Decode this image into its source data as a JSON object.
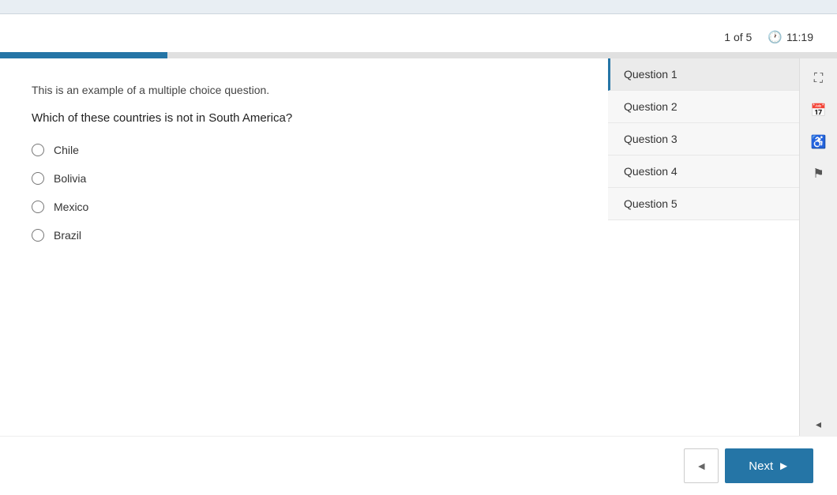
{
  "top_bar": {},
  "header": {
    "page_indicator": "1 of 5",
    "timer_label": "11:19"
  },
  "progress": {
    "fill_percent": 20
  },
  "question": {
    "description": "This is an example of a multiple choice question.",
    "text": "Which of these countries is not in South America?",
    "options": [
      {
        "id": "opt1",
        "label": "Chile"
      },
      {
        "id": "opt2",
        "label": "Bolivia"
      },
      {
        "id": "opt3",
        "label": "Mexico"
      },
      {
        "id": "opt4",
        "label": "Brazil"
      }
    ]
  },
  "nav": {
    "items": [
      {
        "id": "q1",
        "label": "Question 1",
        "active": true
      },
      {
        "id": "q2",
        "label": "Question 2",
        "active": false
      },
      {
        "id": "q3",
        "label": "Question 3",
        "active": false
      },
      {
        "id": "q4",
        "label": "Question 4",
        "active": false
      },
      {
        "id": "q5",
        "label": "Question 5",
        "active": false
      }
    ]
  },
  "icons": {
    "fullscreen": "⛶",
    "calendar": "▦",
    "accessibility": "♿",
    "flag": "⚑",
    "collapse": "◂"
  },
  "buttons": {
    "prev_label": "◄",
    "next_label": "Next",
    "next_arrow": "►"
  }
}
